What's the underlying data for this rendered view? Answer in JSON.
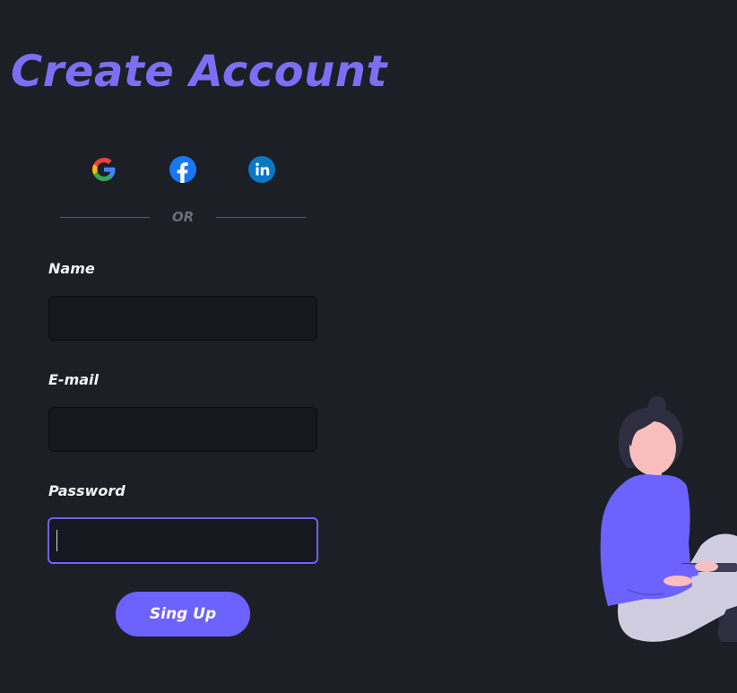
{
  "header": {
    "title": "Create Account"
  },
  "social": {
    "google_icon": "google-icon",
    "facebook_icon": "facebook-icon",
    "linkedin_icon": "linkedin-icon"
  },
  "divider": {
    "text": "OR"
  },
  "form": {
    "name": {
      "label": "Name",
      "value": ""
    },
    "email": {
      "label": "E-mail",
      "value": ""
    },
    "password": {
      "label": "Password",
      "value": ""
    },
    "submit_label": "Sing Up"
  },
  "colors": {
    "background": "#1d1f27",
    "accent": "#6c63ff",
    "title": "#7c6ff4",
    "input_bg": "#16171f"
  }
}
